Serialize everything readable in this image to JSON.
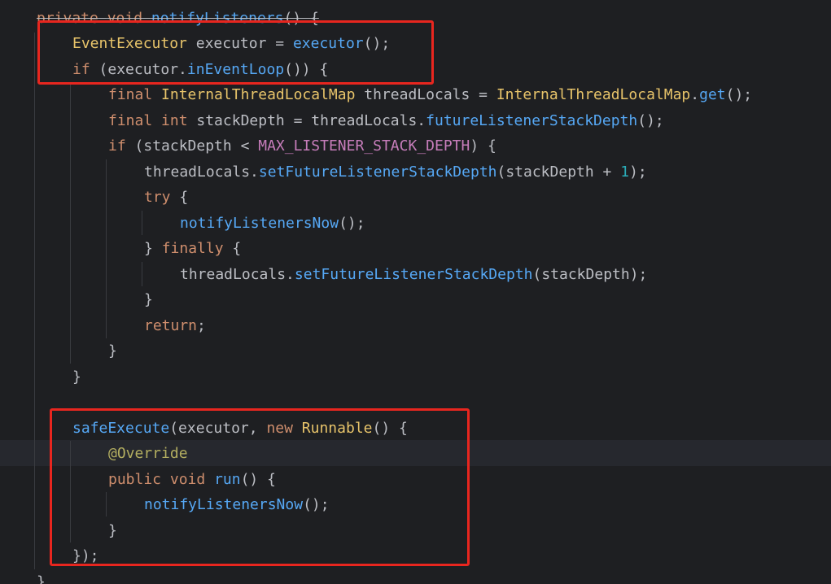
{
  "editor": {
    "lines": {
      "l0": {
        "kw1": "private",
        "kw2": "void",
        "fn": "notifyListeners",
        "rest": "() {"
      },
      "l1": {
        "ty": "EventExecutor",
        "mid": " executor = ",
        "fn": "executor",
        "rest": "();"
      },
      "l2": {
        "kw": "if",
        "mid": " (executor.",
        "fn": "inEventLoop",
        "rest": "()) {"
      },
      "l3": {
        "kw": "final",
        "ty1": "InternalThreadLocalMap",
        "mid": " threadLocals = ",
        "ty2": "InternalThreadLocalMap",
        "dot": ".",
        "fn": "get",
        "rest": "();"
      },
      "l4": {
        "kw1": "final",
        "kw2": "int",
        "mid": " stackDepth = threadLocals.",
        "fn": "futureListenerStackDepth",
        "rest": "();"
      },
      "l5": {
        "kw": "if",
        "mid": " (stackDepth < ",
        "cst": "MAX_LISTENER_STACK_DEPTH",
        "rest": ") {"
      },
      "l6": {
        "pre": "threadLocals.",
        "fn": "setFutureListenerStackDepth",
        "mid": "(stackDepth + ",
        "num": "1",
        "rest": ");"
      },
      "l7": {
        "kw": "try",
        "rest": " {"
      },
      "l8": {
        "fn": "notifyListenersNow",
        "rest": "();"
      },
      "l9": {
        "pre": "} ",
        "kw": "finally",
        "rest": " {"
      },
      "l10": {
        "pre": "threadLocals.",
        "fn": "setFutureListenerStackDepth",
        "rest": "(stackDepth);"
      },
      "l11": {
        "text": "}"
      },
      "l12": {
        "kw": "return",
        "rest": ";"
      },
      "l13": {
        "text": "}"
      },
      "l14": {
        "text": "}"
      },
      "l16": {
        "fn": "safeExecute",
        "mid": "(executor, ",
        "kw": "new",
        "ty": "Runnable",
        "rest": "() {"
      },
      "l17": {
        "ann": "@Override"
      },
      "l18": {
        "kw1": "public",
        "kw2": "void",
        "fn": "run",
        "rest": "() {"
      },
      "l19": {
        "fn": "notifyListenersNow",
        "rest": "();"
      },
      "l20": {
        "text": "}"
      },
      "l21": {
        "text": "});"
      },
      "l22": {
        "text": "}"
      }
    }
  },
  "colors": {
    "background": "#1e1f22",
    "keyword": "#cf8e6d",
    "type": "#e8c46a",
    "method": "#56a8f5",
    "constant": "#c77dbb",
    "number": "#2aacb8",
    "annotation": "#b3ae60",
    "text": "#bcbec4",
    "highlight_box": "#e8261f"
  }
}
